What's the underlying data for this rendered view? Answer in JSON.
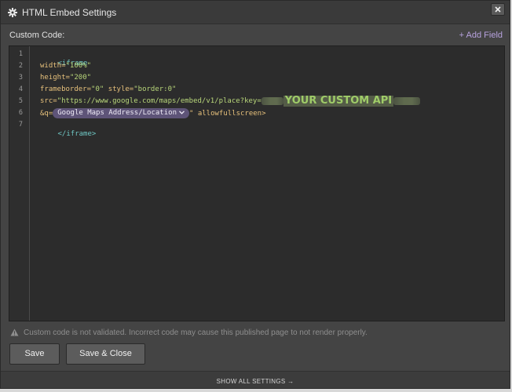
{
  "window": {
    "title": "HTML Embed Settings",
    "title_icon": "gear-icon",
    "close_icon": "close-icon"
  },
  "field": {
    "label": "Custom Code:",
    "add_field": "+ Add Field"
  },
  "editor": {
    "line_numbers": [
      "1",
      "2",
      "3",
      "4",
      "5",
      "6",
      "7"
    ],
    "line1": {
      "tag": "<iframe"
    },
    "line2": {
      "attr": "width=",
      "value": "\"100%\""
    },
    "line3": {
      "attr": "height=",
      "value": "\"200\""
    },
    "line4": {
      "attr1": "frameborder=",
      "value1": "\"0\"",
      "attr2": " style=",
      "value2": "\"border:0\""
    },
    "line5": {
      "attr": "src=",
      "value": "\"https://www.google.com/maps/embed/v1/place?key=",
      "overlay": "YOUR CUSTOM API"
    },
    "line6": {
      "prefix": "&q=",
      "pill": "Google Maps Address/Location",
      "suffix": "\" allowfullscreen>"
    },
    "line7": {
      "tag": "</iframe>"
    }
  },
  "warning": {
    "icon": "warning-icon",
    "text": "Custom code is not validated. Incorrect code may cause this published page to not render properly."
  },
  "buttons": {
    "save": "Save",
    "save_close": "Save & Close"
  },
  "footer": {
    "show_all": "SHOW ALL SETTINGS →"
  },
  "colors": {
    "background": "#444444",
    "editor_bg": "#2c2c2c",
    "accent": "#b7a2de",
    "pill": "#5e5478",
    "api_text": "#9fcc68"
  }
}
